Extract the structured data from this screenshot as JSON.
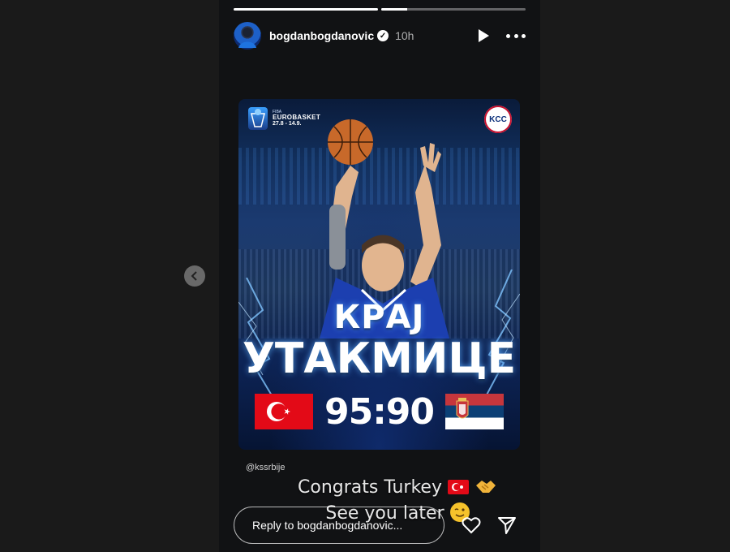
{
  "story": {
    "progress": [
      1.0,
      0.18
    ],
    "username": "bogdanbogdanovic",
    "verified": true,
    "time": "10h",
    "post": {
      "event_logo": {
        "fiba": "FIBA",
        "name": "EUROBASKET",
        "dates": "27.8 - 14.9."
      },
      "partner_logo": "KCC",
      "title_line1": "КРАЈ",
      "title_line2": "УТАКМИЦЕ",
      "score": "95:90",
      "team_left_flag": "turkey-flag",
      "team_right_flag": "serbia-flag"
    },
    "mention": "@kssrbije",
    "caption": {
      "line1": "Congrats Turkey",
      "line2": "See you later"
    },
    "reply": {
      "placeholder": "Reply to bogdanbogdanovic..."
    }
  },
  "colors": {
    "turkey_red": "#e30a17",
    "serbia_red": "#c6363c",
    "serbia_blue": "#0c4076",
    "background": "#111214"
  }
}
